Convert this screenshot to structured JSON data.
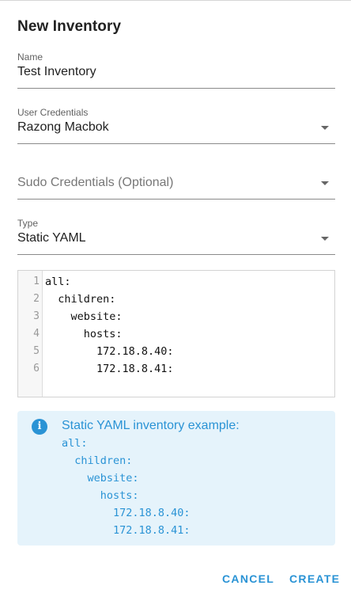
{
  "dialog": {
    "title": "New Inventory"
  },
  "form": {
    "name": {
      "label": "Name",
      "value": "Test Inventory"
    },
    "user_credentials": {
      "label": "User Credentials",
      "value": "Razong Macbok"
    },
    "sudo_credentials": {
      "placeholder": "Sudo Credentials (Optional)"
    },
    "type": {
      "label": "Type",
      "value": "Static YAML"
    }
  },
  "editor": {
    "line_numbers": [
      "1",
      "2",
      "3",
      "4",
      "5",
      "6"
    ],
    "lines": [
      "all:",
      "  children:",
      "    website:",
      "      hosts:",
      "        172.18.8.40:",
      "        172.18.8.41:"
    ]
  },
  "info_alert": {
    "icon": "info-icon",
    "title": "Static YAML inventory example:",
    "lines": [
      "all:",
      "  children:",
      "    website:",
      "      hosts:",
      "        172.18.8.40:",
      "        172.18.8.41:"
    ]
  },
  "actions": {
    "cancel_label": "CANCEL",
    "create_label": "CREATE"
  },
  "colors": {
    "accent": "#2a93d5",
    "alert_background": "#e5f3fb"
  }
}
